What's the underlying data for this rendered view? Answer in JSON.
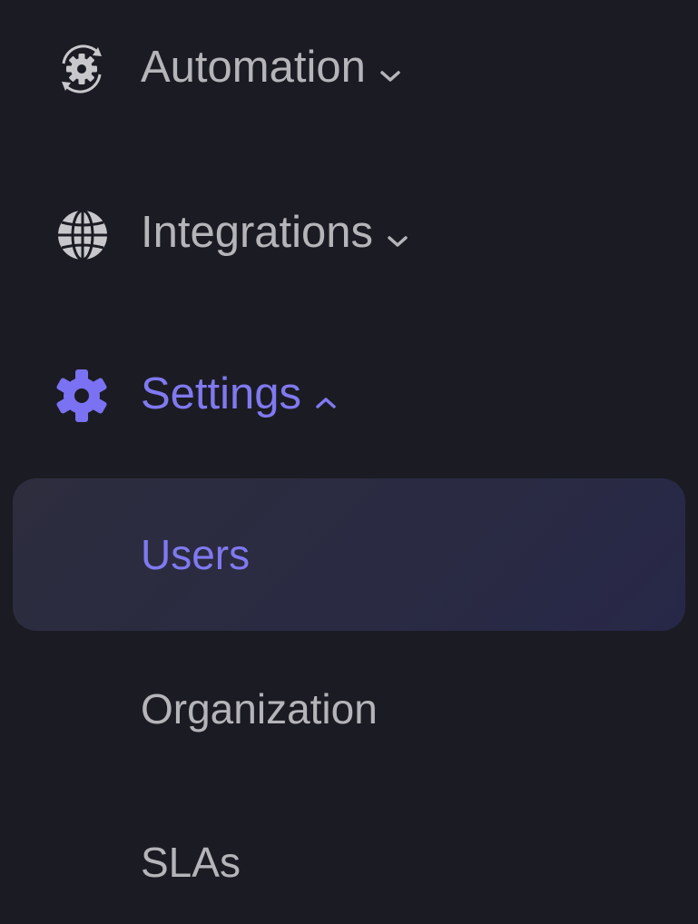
{
  "sidebar": {
    "items": [
      {
        "label": "Automation",
        "icon": "gear-sync-icon",
        "expanded": false
      },
      {
        "label": "Integrations",
        "icon": "globe-icon",
        "expanded": false
      },
      {
        "label": "Settings",
        "icon": "gear-icon",
        "expanded": true,
        "active": true
      }
    ],
    "settings_subitems": [
      {
        "label": "Users",
        "active": true
      },
      {
        "label": "Organization",
        "active": false
      },
      {
        "label": "SLAs",
        "active": false
      }
    ]
  },
  "colors": {
    "background": "#1b1b23",
    "text": "#b4b4b9",
    "accent": "#8079f0",
    "active_bg": "#2b2b40"
  }
}
